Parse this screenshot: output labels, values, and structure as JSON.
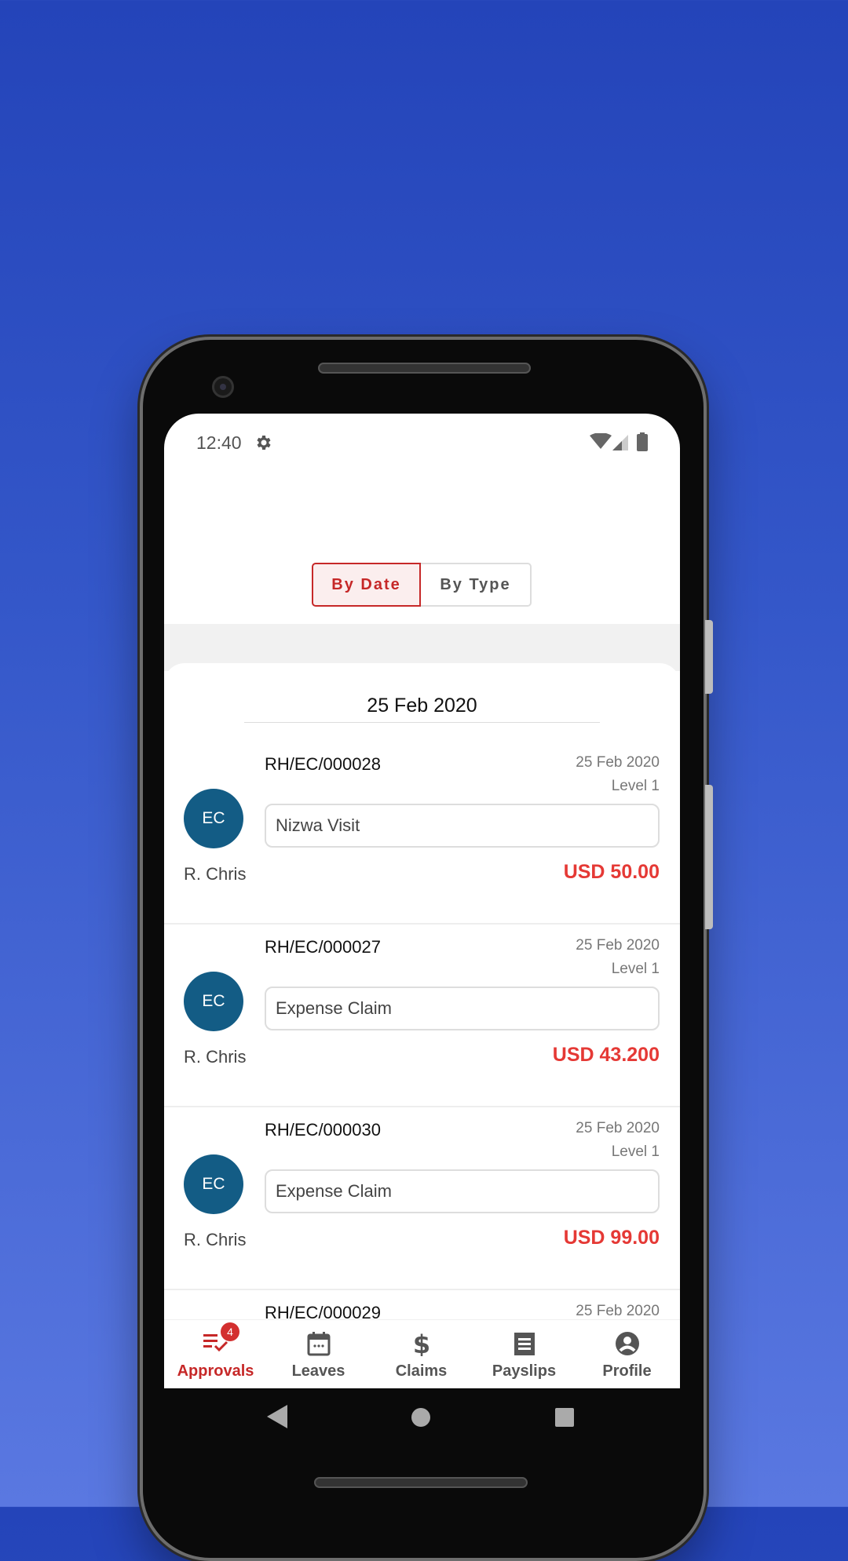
{
  "status_bar": {
    "time": "12:40"
  },
  "toggle": {
    "by_date": "By Date",
    "by_type": "By Type",
    "selected": "By Date"
  },
  "group": {
    "date": "25 Feb 2020"
  },
  "items": [
    {
      "ref": "RH/EC/000028",
      "date": "25 Feb 2020",
      "level": "Level 1",
      "initials": "EC",
      "description": "Nizwa Visit",
      "name": "R. Chris",
      "amount": "USD 50.00"
    },
    {
      "ref": "RH/EC/000027",
      "date": "25 Feb 2020",
      "level": "Level 1",
      "initials": "EC",
      "description": "Expense Claim",
      "name": "R. Chris",
      "amount": "USD 43.200"
    },
    {
      "ref": "RH/EC/000030",
      "date": "25 Feb 2020",
      "level": "Level 1",
      "initials": "EC",
      "description": "Expense Claim",
      "name": "R. Chris",
      "amount": "USD 99.00"
    },
    {
      "ref": "RH/EC/000029",
      "date": "25 Feb 2020"
    }
  ],
  "bottom_nav": {
    "items": [
      {
        "label": "Approvals",
        "icon": "approvals-check-list-icon",
        "badge": "4",
        "active": true
      },
      {
        "label": "Leaves",
        "icon": "calendar-icon"
      },
      {
        "label": "Claims",
        "icon": "dollar-icon"
      },
      {
        "label": "Payslips",
        "icon": "receipt-icon"
      },
      {
        "label": "Profile",
        "icon": "account-circle-icon"
      }
    ]
  },
  "colors": {
    "accent": "#c62828",
    "amount": "#e53935",
    "avatar": "#135c85"
  }
}
